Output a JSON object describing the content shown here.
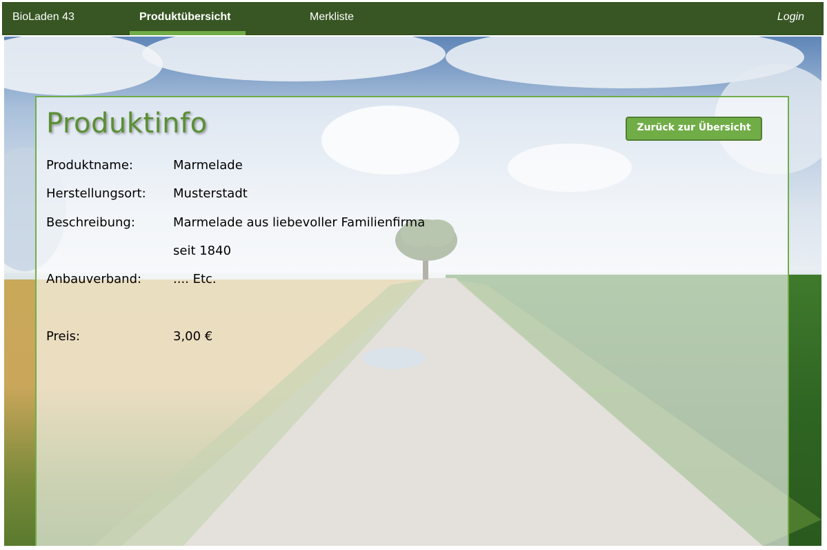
{
  "nav": {
    "brand": "BioLaden 43",
    "products": "Produktübersicht",
    "wishlist": "Merkliste",
    "login": "Login"
  },
  "panel": {
    "title": "Produktinfo",
    "back_button": "Zurück zur Übersicht",
    "fields": {
      "name_label": "Produktname:",
      "name_value": "Marmelade",
      "origin_label": "Herstellungsort:",
      "origin_value": "Musterstadt",
      "description_label": "Beschreibung:",
      "description_line1": "Marmelade aus liebevoller Familienfirma",
      "description_line2": "seit 1840",
      "association_label": "Anbauverband:",
      "association_value": ".... Etc.",
      "price_label": "Preis:",
      "price_value": "3,00 €"
    }
  },
  "colors": {
    "nav_background": "#375623",
    "accent_green": "#70ad47",
    "title_green": "#5b8f34"
  }
}
